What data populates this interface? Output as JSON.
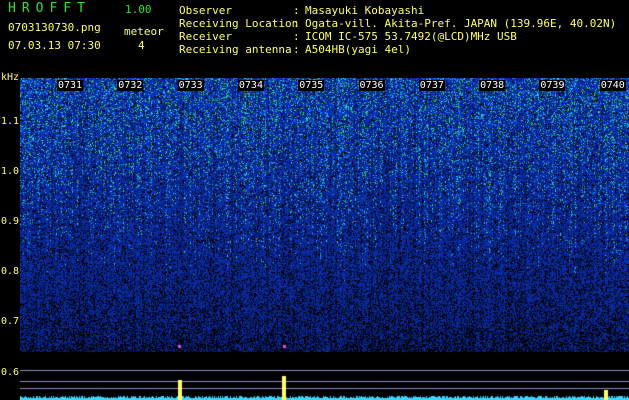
{
  "header": {
    "app_title": "HROFFT",
    "app_version": "1.00",
    "file_name": "0703130730.png",
    "date_time": "07.03.13 07:30",
    "meteor_label": "meteor",
    "meteor_count": "4"
  },
  "info": {
    "observer_key": "Observer",
    "observer_val": "Masayuki Kobayashi",
    "location_key": "Receiving Location",
    "location_val": "Ogata-vill. Akita-Pref. JAPAN (139.96E, 40.02N)",
    "receiver_key": "Receiver",
    "receiver_val": "ICOM IC-575 53.7492(@LCD)MHz USB",
    "antenna_key": "Receiving antenna",
    "antenna_val": "A504HB(yagi 4el)",
    "colon": ":"
  },
  "chart_data": {
    "type": "heatmap",
    "ylabel": "kHz",
    "y_ticks": [
      "1.1",
      "1.0",
      "0.9",
      "0.8",
      "0.7",
      "0.6"
    ],
    "x_ticks": [
      "0731",
      "0732",
      "0733",
      "0734",
      "0735",
      "0736",
      "0737",
      "0738",
      "0739",
      "0740"
    ],
    "colors": {
      "background": "#000000",
      "noise": "#1a2fd0",
      "strong": "#2ee02e",
      "signal": "#ffff66"
    }
  }
}
